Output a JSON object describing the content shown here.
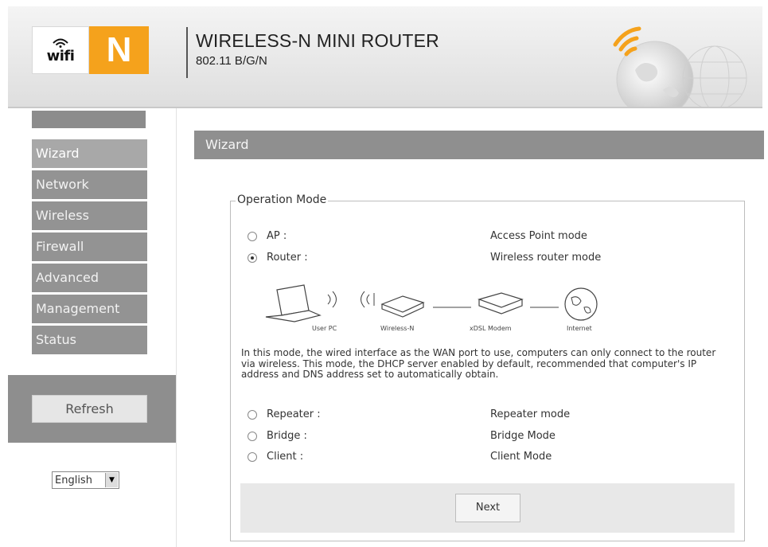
{
  "header": {
    "logo_wifi": "wifi",
    "logo_n": "N",
    "title": "WIRELESS-N MINI ROUTER",
    "subtitle": "802.11 B/G/N"
  },
  "sidebar": {
    "items": [
      {
        "label": "Wizard",
        "active": true
      },
      {
        "label": "Network",
        "active": false
      },
      {
        "label": "Wireless",
        "active": false
      },
      {
        "label": "Firewall",
        "active": false
      },
      {
        "label": "Advanced",
        "active": false
      },
      {
        "label": "Management",
        "active": false
      },
      {
        "label": "Status",
        "active": false
      }
    ],
    "refresh_label": "Refresh",
    "language_selected": "English"
  },
  "main": {
    "section_title": "Wizard",
    "group_legend": "Operation Mode",
    "modes": [
      {
        "label": "AP :",
        "description": "Access Point mode",
        "checked": false
      },
      {
        "label": "Router :",
        "description": "Wireless router mode",
        "checked": true
      },
      {
        "label": "Repeater :",
        "description": "Repeater mode",
        "checked": false
      },
      {
        "label": "Bridge :",
        "description": "Bridge Mode",
        "checked": false
      },
      {
        "label": "Client :",
        "description": "Client Mode",
        "checked": false
      }
    ],
    "diagram": {
      "user_pc": "User PC",
      "wireless_n": "Wireless-N",
      "adsl_modem": "xDSL Modem",
      "internet": "Internet"
    },
    "mode_description": "In this mode, the wired interface as the WAN port to use, computers can only connect to the router via wireless. This mode, the DHCP server enabled by default, recommended that computer's IP address and DNS address set to automatically obtain.",
    "next_label": "Next"
  },
  "colors": {
    "nav_bg": "#939393",
    "brand_orange": "#f5a21c",
    "title_bar": "#8f8f8f"
  }
}
